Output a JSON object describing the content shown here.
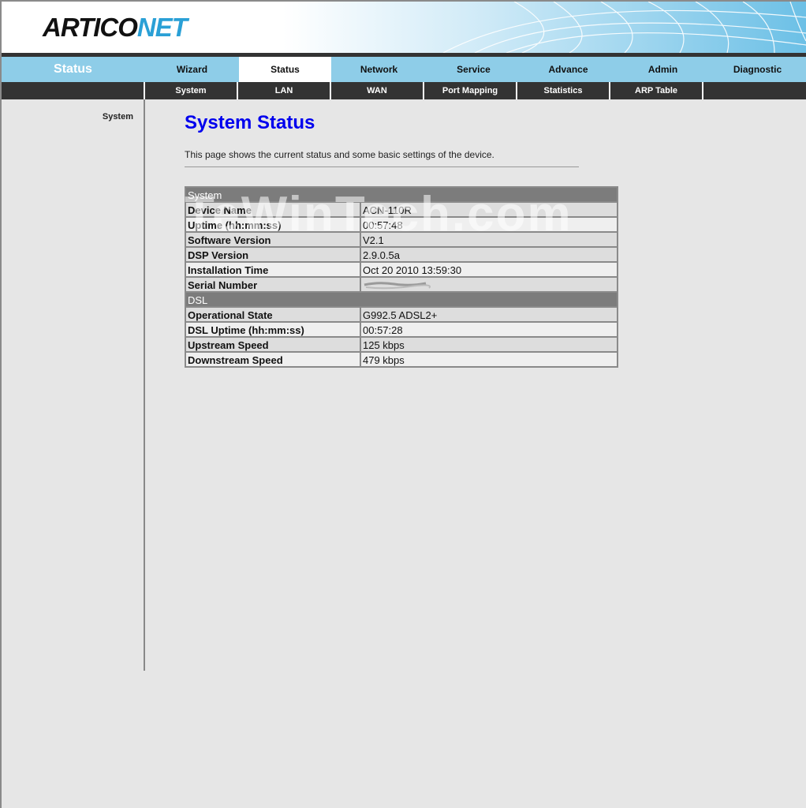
{
  "brand": {
    "logo_part1": "ARTICO",
    "logo_part2": "NET",
    "accent": "#2aa0d6"
  },
  "mainnav": {
    "current_section": "Status",
    "tabs": [
      "Wizard",
      "Status",
      "Network",
      "Service",
      "Advance",
      "Admin",
      "Diagnostic"
    ],
    "active": "Status"
  },
  "subnav": {
    "tabs": [
      "System",
      "LAN",
      "WAN",
      "Port Mapping",
      "Statistics",
      "ARP Table"
    ]
  },
  "sidebar": {
    "items": [
      "System"
    ]
  },
  "main": {
    "title": "System Status",
    "description": "This page shows the current status and some basic settings of the device."
  },
  "table": {
    "system_header": "System",
    "system_rows": [
      {
        "label": "Device Name",
        "value": "ACN-110R"
      },
      {
        "label": "Uptime (hh:mm:ss)",
        "value": "00:57:48"
      },
      {
        "label": "Software Version",
        "value": "V2.1"
      },
      {
        "label": "DSP Version",
        "value": "2.9.0.5a"
      },
      {
        "label": "Installation Time",
        "value": "Oct 20 2010 13:59:30"
      },
      {
        "label": "Serial Number",
        "value": ""
      }
    ],
    "dsl_header": "DSL",
    "dsl_rows": [
      {
        "label": "Operational State",
        "value": "G992.5 ADSL2+"
      },
      {
        "label": "DSL Uptime (hh:mm:ss)",
        "value": "00:57:28"
      },
      {
        "label": "Upstream Speed",
        "value": "125 kbps"
      },
      {
        "label": "Downstream Speed",
        "value": "479 kbps"
      }
    ]
  },
  "watermark": "TeWinTech.com"
}
